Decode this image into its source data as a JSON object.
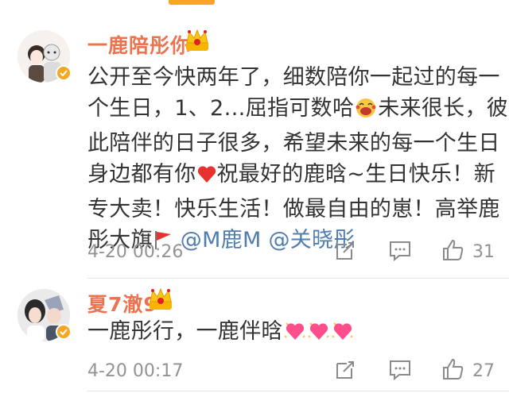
{
  "comments": [
    {
      "username": "一鹿陪彤你",
      "lines": [
        {
          "text": "公开至今快两年了，细数陪你一起过的每一"
        },
        {
          "text": "个生日，1、2…屈指可数哈",
          "emoji": "laughing-face-emoji",
          "after": "未来很长，彼"
        },
        {
          "text": "此陪伴的日子很多，希望未来的每一个生日"
        },
        {
          "text": "身边都有你",
          "emoji": "red-heart-emoji",
          "after": "祝最好的鹿晗~生日快乐！新"
        },
        {
          "text": "专大卖！快乐生活！做最自由的崽！高举鹿"
        },
        {
          "text": "彤大旗",
          "emoji": "red-flag-emoji",
          "mention1": "@M鹿M",
          "mention2": "@关晓彤"
        }
      ],
      "time": "4-20 00:26",
      "likes": "31"
    },
    {
      "username": "夏7澈9",
      "lines": [
        {
          "text": "一鹿彤行，一鹿伴晗"
        }
      ],
      "time": "4-20 00:17",
      "likes": "27"
    }
  ],
  "colors": {
    "username": "#eb7350",
    "mention": "#507daf",
    "text": "#333333",
    "meta": "#939393",
    "accent": "#f5a623"
  }
}
